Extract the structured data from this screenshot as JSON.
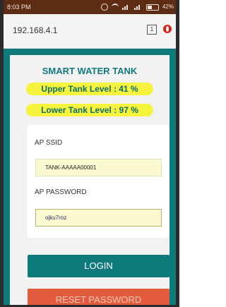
{
  "status_bar": {
    "time": "8:03 PM",
    "battery_percent": "42%",
    "icons": [
      "alarm-icon",
      "wifi-icon",
      "signal-icon",
      "signal-icon",
      "battery-icon"
    ]
  },
  "browser": {
    "url": "192.168.4.1",
    "tab_count": "1",
    "menu_icon": "opera-icon"
  },
  "page": {
    "title": "SMART WATER TANK",
    "upper_level": "Upper Tank Level : 41 %",
    "lower_level": "Lower Tank Level : 97 %"
  },
  "form": {
    "ssid_label": "AP SSID",
    "ssid_value": "TANK-AAAAA00001",
    "password_label": "AP PASSWORD",
    "password_value": "ojku7roz",
    "login_label": "LOGIN",
    "reset_label": "RESET PASSWORD"
  },
  "colors": {
    "teal": "#0f7a7c",
    "level_highlight": "#f6f33c",
    "reset_button": "#e35b3d",
    "status_bar": "#5e2b13"
  }
}
